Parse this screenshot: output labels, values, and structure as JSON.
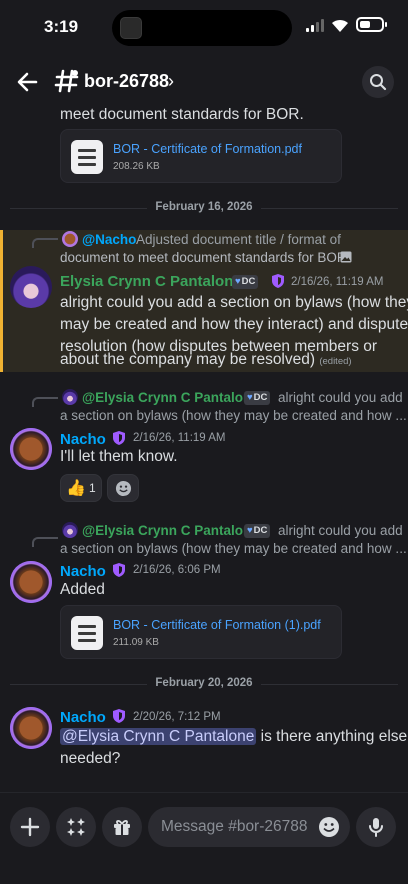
{
  "status_bar": {
    "time": "3:19"
  },
  "header": {
    "channel_name": "bor-26788",
    "chevron": "›"
  },
  "messages": {
    "top_fragment": "meet document standards for BOR.",
    "attachment1": {
      "name": "BOR - Certificate of Formation.pdf",
      "size": "208.26 KB"
    },
    "date1": "February 16, 2026",
    "msg1": {
      "reply_user": "@Nacho",
      "reply_line1": "Adjusted document title / format of",
      "reply_line2": "document to meet document standards for BOR.",
      "author": "Elysia Crynn C Pantalone",
      "tag": "DC",
      "timestamp": "2/16/26, 11:19 AM",
      "lines": [
        "alright could you add a section on bylaws (how they",
        "may be created and how they interact) and dispute",
        "resolution (how disputes between members or",
        "about the company may be resolved)"
      ],
      "edited": "(edited)"
    },
    "msg2": {
      "reply_user": "@Elysia Crynn C Pantalone",
      "reply_tag": "DC",
      "reply_line1": "alright could you add",
      "reply_line2": "a section on bylaws (how they may be created and how ...",
      "author": "Nacho",
      "timestamp": "2/16/26, 11:19 AM",
      "text": "I'll let them know.",
      "reaction_count": "1"
    },
    "msg3": {
      "reply_user": "@Elysia Crynn C Pantalone",
      "reply_tag": "DC",
      "reply_line1": "alright could you add",
      "reply_line2": "a section on bylaws (how they may be created and how ...",
      "author": "Nacho",
      "timestamp": "2/16/26, 6:06 PM",
      "text": "Added"
    },
    "attachment2": {
      "name": "BOR - Certificate of Formation (1).pdf",
      "size": "211.09 KB"
    },
    "date2": "February 20, 2026",
    "msg4": {
      "author": "Nacho",
      "timestamp": "2/20/26, 7:12 PM",
      "mention": "@Elysia Crynn C Pantalone",
      "text_after": " is there anything else",
      "line2": "needed?"
    }
  },
  "input": {
    "placeholder": "Message #bor-26788"
  },
  "colors": {
    "accent_blue": "#00a8fc",
    "name_green": "#3ba55c",
    "highlight_gold": "#f0b232",
    "link": "#4aa3ff"
  }
}
